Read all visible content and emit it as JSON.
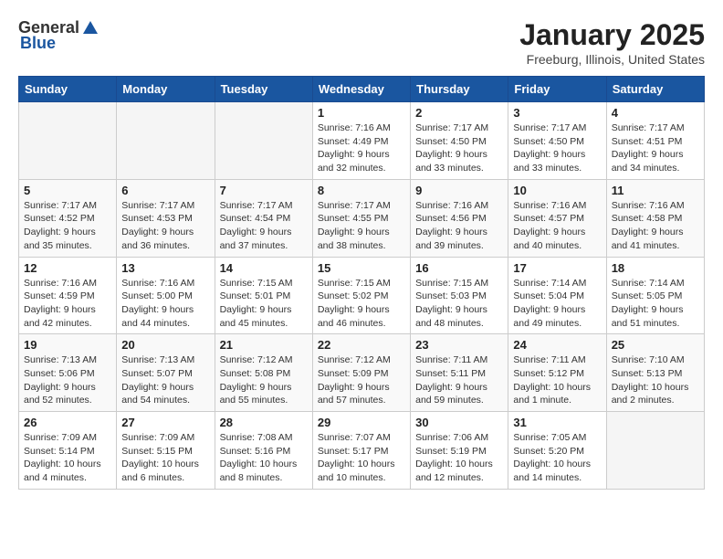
{
  "header": {
    "logo_general": "General",
    "logo_blue": "Blue",
    "title": "January 2025",
    "subtitle": "Freeburg, Illinois, United States"
  },
  "weekdays": [
    "Sunday",
    "Monday",
    "Tuesday",
    "Wednesday",
    "Thursday",
    "Friday",
    "Saturday"
  ],
  "weeks": [
    [
      {
        "day": "",
        "info": ""
      },
      {
        "day": "",
        "info": ""
      },
      {
        "day": "",
        "info": ""
      },
      {
        "day": "1",
        "info": "Sunrise: 7:16 AM\nSunset: 4:49 PM\nDaylight: 9 hours and 32 minutes."
      },
      {
        "day": "2",
        "info": "Sunrise: 7:17 AM\nSunset: 4:50 PM\nDaylight: 9 hours and 33 minutes."
      },
      {
        "day": "3",
        "info": "Sunrise: 7:17 AM\nSunset: 4:50 PM\nDaylight: 9 hours and 33 minutes."
      },
      {
        "day": "4",
        "info": "Sunrise: 7:17 AM\nSunset: 4:51 PM\nDaylight: 9 hours and 34 minutes."
      }
    ],
    [
      {
        "day": "5",
        "info": "Sunrise: 7:17 AM\nSunset: 4:52 PM\nDaylight: 9 hours and 35 minutes."
      },
      {
        "day": "6",
        "info": "Sunrise: 7:17 AM\nSunset: 4:53 PM\nDaylight: 9 hours and 36 minutes."
      },
      {
        "day": "7",
        "info": "Sunrise: 7:17 AM\nSunset: 4:54 PM\nDaylight: 9 hours and 37 minutes."
      },
      {
        "day": "8",
        "info": "Sunrise: 7:17 AM\nSunset: 4:55 PM\nDaylight: 9 hours and 38 minutes."
      },
      {
        "day": "9",
        "info": "Sunrise: 7:16 AM\nSunset: 4:56 PM\nDaylight: 9 hours and 39 minutes."
      },
      {
        "day": "10",
        "info": "Sunrise: 7:16 AM\nSunset: 4:57 PM\nDaylight: 9 hours and 40 minutes."
      },
      {
        "day": "11",
        "info": "Sunrise: 7:16 AM\nSunset: 4:58 PM\nDaylight: 9 hours and 41 minutes."
      }
    ],
    [
      {
        "day": "12",
        "info": "Sunrise: 7:16 AM\nSunset: 4:59 PM\nDaylight: 9 hours and 42 minutes."
      },
      {
        "day": "13",
        "info": "Sunrise: 7:16 AM\nSunset: 5:00 PM\nDaylight: 9 hours and 44 minutes."
      },
      {
        "day": "14",
        "info": "Sunrise: 7:15 AM\nSunset: 5:01 PM\nDaylight: 9 hours and 45 minutes."
      },
      {
        "day": "15",
        "info": "Sunrise: 7:15 AM\nSunset: 5:02 PM\nDaylight: 9 hours and 46 minutes."
      },
      {
        "day": "16",
        "info": "Sunrise: 7:15 AM\nSunset: 5:03 PM\nDaylight: 9 hours and 48 minutes."
      },
      {
        "day": "17",
        "info": "Sunrise: 7:14 AM\nSunset: 5:04 PM\nDaylight: 9 hours and 49 minutes."
      },
      {
        "day": "18",
        "info": "Sunrise: 7:14 AM\nSunset: 5:05 PM\nDaylight: 9 hours and 51 minutes."
      }
    ],
    [
      {
        "day": "19",
        "info": "Sunrise: 7:13 AM\nSunset: 5:06 PM\nDaylight: 9 hours and 52 minutes."
      },
      {
        "day": "20",
        "info": "Sunrise: 7:13 AM\nSunset: 5:07 PM\nDaylight: 9 hours and 54 minutes."
      },
      {
        "day": "21",
        "info": "Sunrise: 7:12 AM\nSunset: 5:08 PM\nDaylight: 9 hours and 55 minutes."
      },
      {
        "day": "22",
        "info": "Sunrise: 7:12 AM\nSunset: 5:09 PM\nDaylight: 9 hours and 57 minutes."
      },
      {
        "day": "23",
        "info": "Sunrise: 7:11 AM\nSunset: 5:11 PM\nDaylight: 9 hours and 59 minutes."
      },
      {
        "day": "24",
        "info": "Sunrise: 7:11 AM\nSunset: 5:12 PM\nDaylight: 10 hours and 1 minute."
      },
      {
        "day": "25",
        "info": "Sunrise: 7:10 AM\nSunset: 5:13 PM\nDaylight: 10 hours and 2 minutes."
      }
    ],
    [
      {
        "day": "26",
        "info": "Sunrise: 7:09 AM\nSunset: 5:14 PM\nDaylight: 10 hours and 4 minutes."
      },
      {
        "day": "27",
        "info": "Sunrise: 7:09 AM\nSunset: 5:15 PM\nDaylight: 10 hours and 6 minutes."
      },
      {
        "day": "28",
        "info": "Sunrise: 7:08 AM\nSunset: 5:16 PM\nDaylight: 10 hours and 8 minutes."
      },
      {
        "day": "29",
        "info": "Sunrise: 7:07 AM\nSunset: 5:17 PM\nDaylight: 10 hours and 10 minutes."
      },
      {
        "day": "30",
        "info": "Sunrise: 7:06 AM\nSunset: 5:19 PM\nDaylight: 10 hours and 12 minutes."
      },
      {
        "day": "31",
        "info": "Sunrise: 7:05 AM\nSunset: 5:20 PM\nDaylight: 10 hours and 14 minutes."
      },
      {
        "day": "",
        "info": ""
      }
    ]
  ]
}
